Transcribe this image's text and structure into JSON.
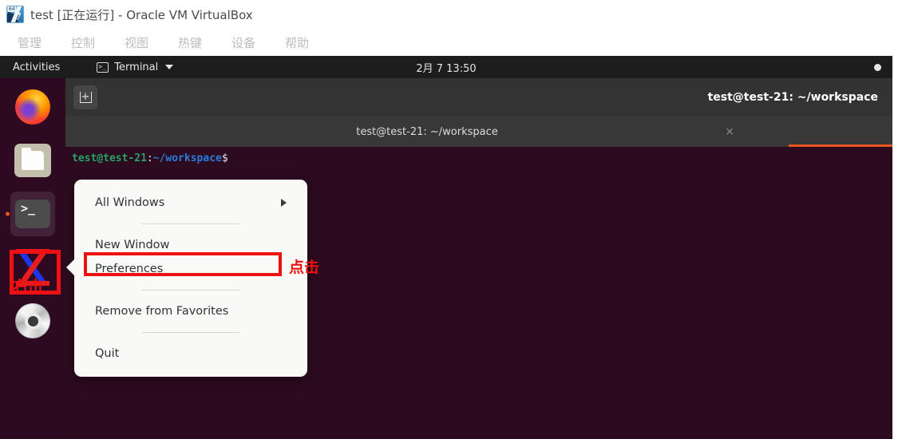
{
  "host_window": {
    "icon_name": "virtualbox-icon",
    "icon_badge_top": "64",
    "icon_badge_bottom": "7",
    "title": "test [正在运行] - Oracle VM VirtualBox",
    "menus": [
      "管理",
      "控制",
      "视图",
      "热键",
      "设备",
      "帮助"
    ]
  },
  "gnome_topbar": {
    "activities": "Activities",
    "app_name": "Terminal",
    "app_icon": "terminal-icon",
    "dropdown_icon": "chevron-down-icon",
    "clock": "2月 7  13:50",
    "status_icon": "status-indicator-dot"
  },
  "dock": {
    "items": [
      {
        "name": "firefox",
        "label": "Firefox",
        "running": false
      },
      {
        "name": "files",
        "label": "Files",
        "running": false
      },
      {
        "name": "terminal",
        "label": "Terminal",
        "running": true
      },
      {
        "name": "xlogo",
        "label": "X",
        "running": false
      },
      {
        "name": "disc",
        "label": "Disc",
        "running": false
      }
    ]
  },
  "terminal_window": {
    "header_title": "test@test-21: ~/workspace",
    "new_tab_icon": "new-tab-icon",
    "tab": {
      "label": "test@test-21: ~/workspace",
      "close_icon": "×"
    },
    "body_lines": [
      {
        "user": "test@test-21",
        "sep": ":",
        "path": "~/workspace",
        "prompt": "$ "
      }
    ]
  },
  "context_menu": {
    "items": [
      {
        "label": "All Windows",
        "has_submenu": true
      },
      {
        "label": "New Window",
        "has_submenu": false
      },
      {
        "label": "Preferences",
        "has_submenu": false
      },
      {
        "label": "Remove from Favorites",
        "has_submenu": false
      },
      {
        "label": "Quit",
        "has_submenu": false
      }
    ]
  },
  "annotations": {
    "dock_label": "右击",
    "menu_label": "点击",
    "color": "#ee1111"
  },
  "colors": {
    "accent_orange": "#e95420",
    "terminal_bg": "#2c0b1f",
    "topbar_bg": "#1d1d1d",
    "headerbar_bg": "#333333",
    "menu_bg": "#f9f9f8"
  }
}
